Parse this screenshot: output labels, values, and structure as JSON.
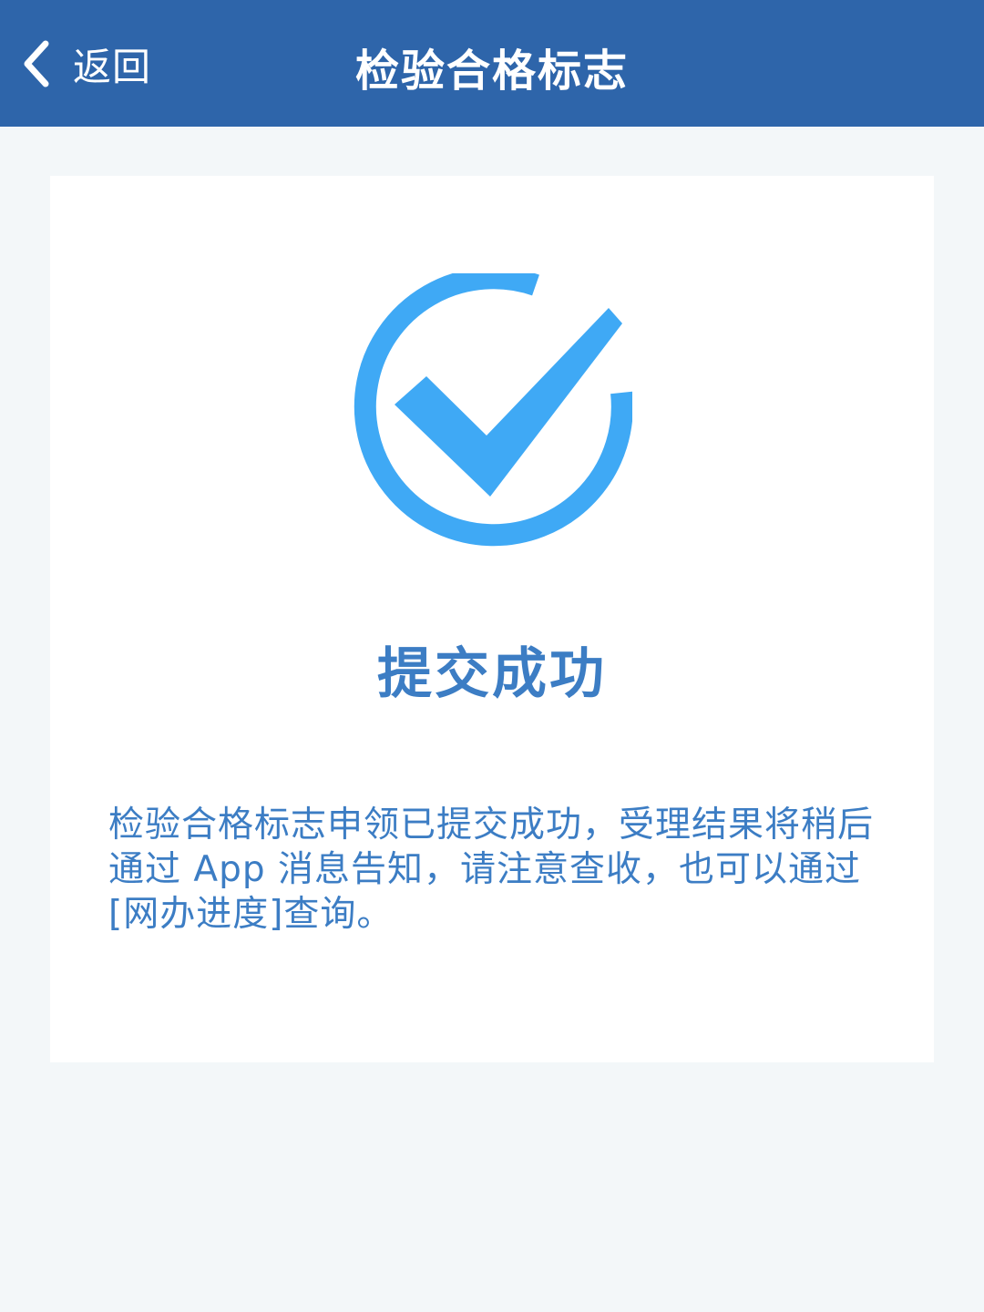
{
  "header": {
    "back_label": "返回",
    "title": "检验合格标志",
    "background_color": "#2e65aa",
    "back_icon": "chevron-left-icon"
  },
  "result": {
    "icon": "check-circle-icon",
    "icon_color": "#3fa9f5",
    "title": "提交成功",
    "message": "检验合格标志申领已提交成功，受理结果将稍后通过 App 消息告知，请注意查收，也可以通过[网办进度]查询。",
    "text_color": "#3c7dc4"
  }
}
